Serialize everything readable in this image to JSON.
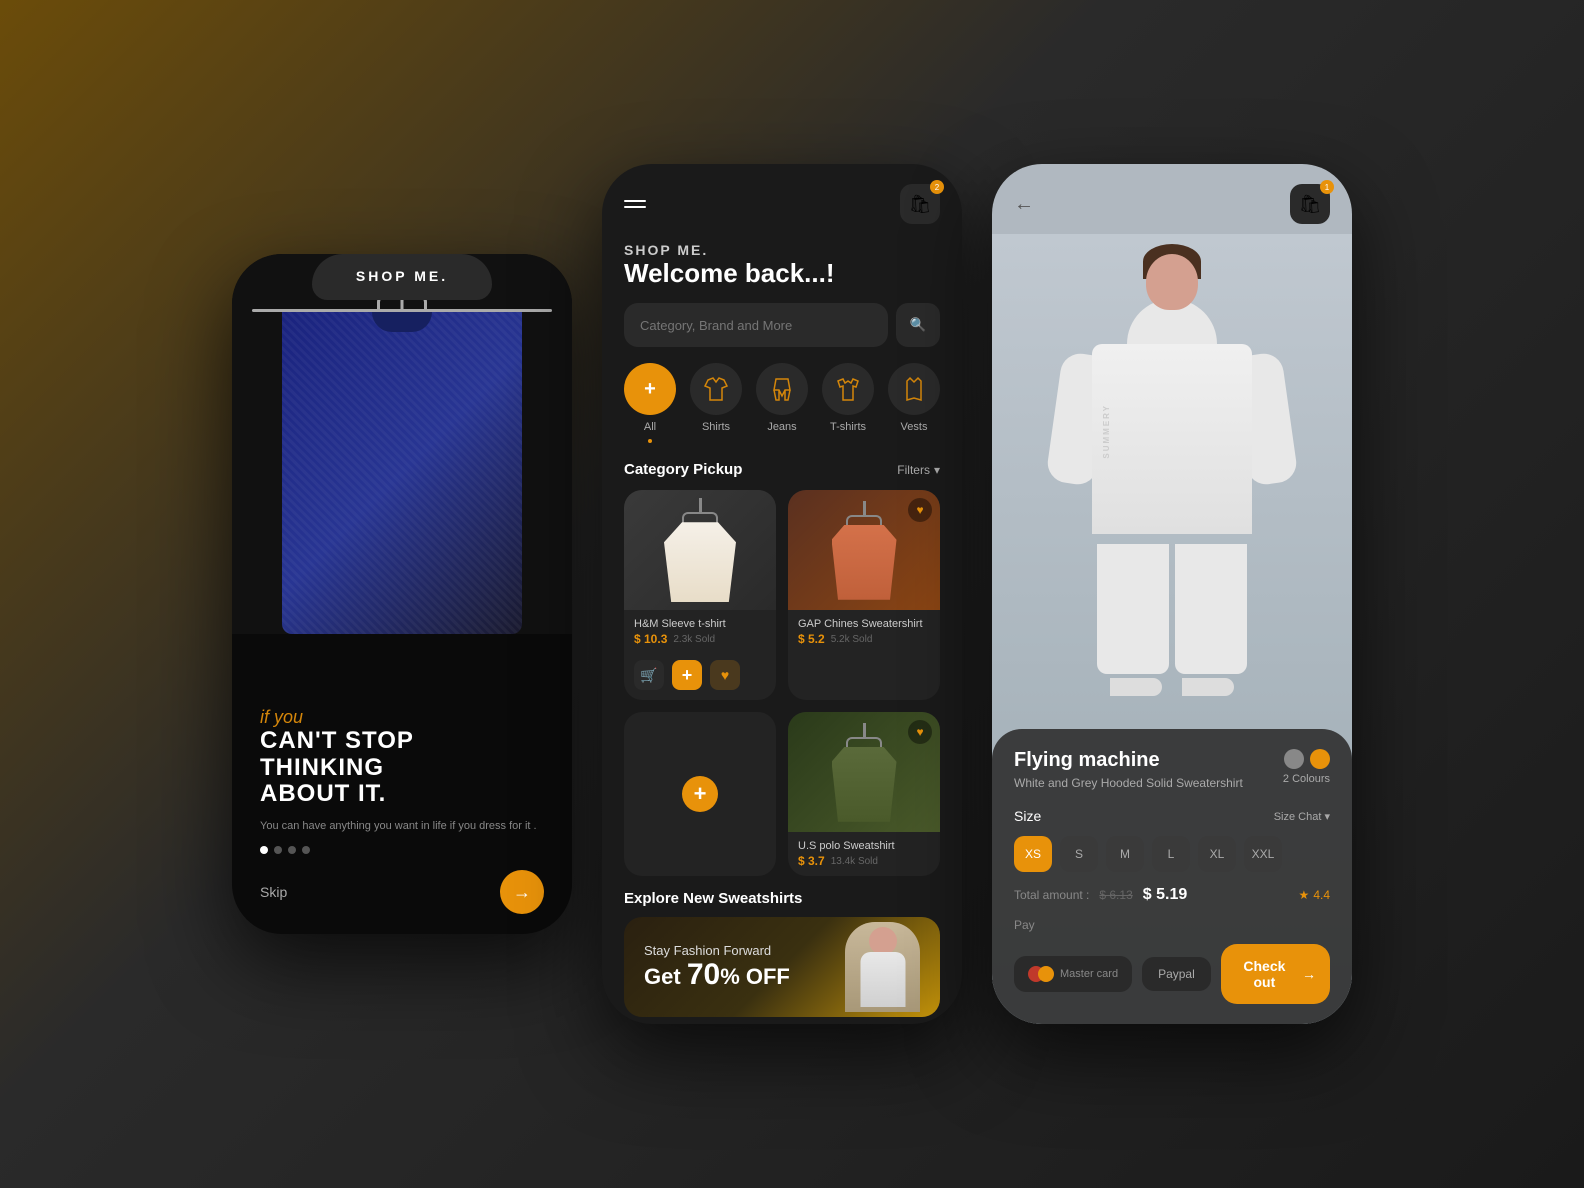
{
  "background": {
    "gradient": "linear-gradient(135deg, #6b4c0a, #2a2a2a, #1a1a1a)"
  },
  "phone1": {
    "header_title": "SHOP ME.",
    "italic_text": "if you",
    "heading_line1": "CAN'T STOP THINKING",
    "heading_line2": "ABOUT IT.",
    "sub_text": "You can have anything you want in life if you dress for it .",
    "skip_label": "Skip",
    "dots": [
      true,
      false,
      false,
      false
    ]
  },
  "phone2": {
    "shop_me_label": "SHOP ME.",
    "welcome_text": "Welcome back...!",
    "search_placeholder": "Category, Brand and More",
    "categories": [
      {
        "label": "All",
        "icon": "+",
        "is_add": true,
        "active": true
      },
      {
        "label": "Shirts",
        "icon": "shirt"
      },
      {
        "label": "Jeans",
        "icon": "jeans"
      },
      {
        "label": "T-shirts",
        "icon": "tshirt"
      },
      {
        "label": "Vests",
        "icon": "vest"
      }
    ],
    "section_category": "Category Pickup",
    "filter_label": "Filters",
    "products": [
      {
        "name": "H&M Sleeve t-shirt",
        "price": "$ 10.3",
        "sold": "2.3k Sold",
        "type": "poncho",
        "has_actions": true
      },
      {
        "name": "GAP Chines Sweatershirt",
        "price": "$ 5.2",
        "sold": "5.2k Sold",
        "type": "orange",
        "has_heart": true
      },
      {
        "name": "",
        "price": "",
        "sold": "",
        "type": "empty_with_plus",
        "has_actions": false
      },
      {
        "name": "U.S polo Sweatshirt",
        "price": "$ 3.7",
        "sold": "13.4k Sold",
        "type": "olive",
        "has_heart": true
      }
    ],
    "explore_title": "Explore New Sweatshirts",
    "promo_stay": "Stay Fashion Forward",
    "promo_discount": "Get",
    "promo_percent": "70",
    "promo_off": "% OFF",
    "cart_badge": "2"
  },
  "phone3": {
    "brand_name": "Flying machine",
    "product_desc": "White and Grey Hooded Solid Sweatershirt",
    "colours_label": "2 Colours",
    "size_label": "Size",
    "size_chat": "Size Chat",
    "sizes": [
      "XS",
      "S",
      "M",
      "L",
      "XL",
      "XXL"
    ],
    "active_size": "XS",
    "total_label": "Total amount :",
    "price_old": "$ 6.13",
    "price_new": "$ 5.19",
    "rating": "4.4",
    "pay_label": "Pay",
    "mastercard_label": "Master card",
    "paypal_label": "Paypal",
    "checkout_label": "Check out",
    "cart_badge": "1"
  },
  "icons": {
    "cart": "🛍",
    "search": "🔍",
    "heart": "♥",
    "arrow_right": "→",
    "back": "←",
    "star": "★",
    "cart_small": "🛒",
    "chevron_down": "▾"
  }
}
